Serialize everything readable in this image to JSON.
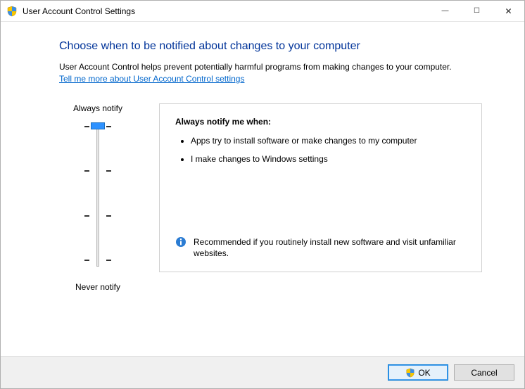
{
  "window": {
    "title": "User Account Control Settings"
  },
  "heading": "Choose when to be notified about changes to your computer",
  "subtext": "User Account Control helps prevent potentially harmful programs from making changes to your computer.",
  "link": "Tell me more about User Account Control settings",
  "slider": {
    "top_label": "Always notify",
    "bottom_label": "Never notify",
    "levels": 4,
    "current_level": 3
  },
  "panel": {
    "title": "Always notify me when:",
    "bullets": [
      "Apps try to install software or make changes to my computer",
      "I make changes to Windows settings"
    ],
    "recommendation": "Recommended if you routinely install new software and visit unfamiliar websites."
  },
  "buttons": {
    "ok": "OK",
    "cancel": "Cancel"
  }
}
